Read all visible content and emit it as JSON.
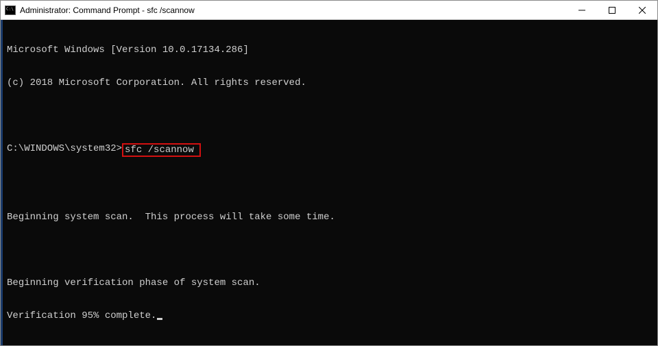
{
  "titlebar": {
    "text": "Administrator: Command Prompt - sfc  /scannow"
  },
  "terminal": {
    "line1": "Microsoft Windows [Version 10.0.17134.286]",
    "line2": "(c) 2018 Microsoft Corporation. All rights reserved.",
    "prompt": "C:\\WINDOWS\\system32>",
    "command": "sfc /scannow",
    "scan_msg": "Beginning system scan.  This process will take some time.",
    "verify_msg": "Beginning verification phase of system scan.",
    "progress_msg": "Verification 95% complete."
  }
}
